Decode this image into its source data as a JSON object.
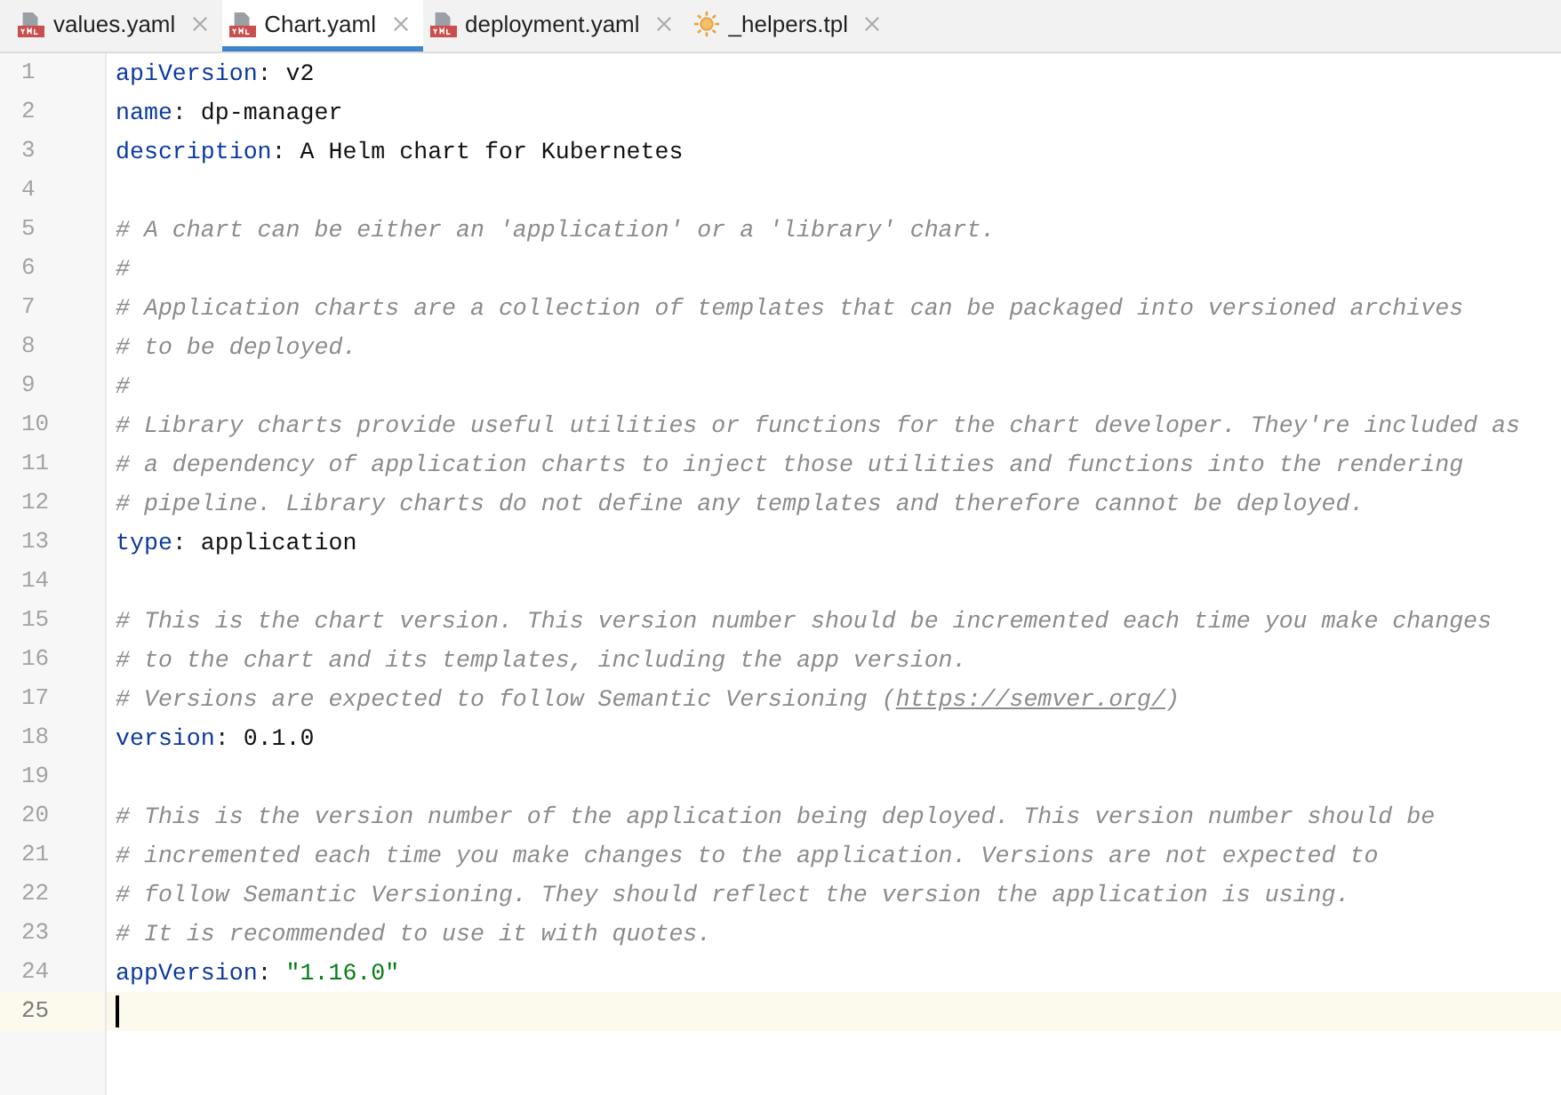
{
  "tabs": [
    {
      "label": "values.yaml",
      "kind": "yaml",
      "selected": false
    },
    {
      "label": "Chart.yaml",
      "kind": "yaml",
      "selected": true
    },
    {
      "label": "deployment.yaml",
      "kind": "yaml",
      "selected": false
    },
    {
      "label": "_helpers.tpl",
      "kind": "template",
      "selected": false
    }
  ],
  "lines": [
    {
      "number": "1",
      "kind": "pair",
      "key": "apiVersion",
      "separator": ":",
      "value": "v2",
      "current": false
    },
    {
      "number": "2",
      "kind": "pair",
      "key": "name",
      "separator": ":",
      "value": "dp-manager",
      "current": false
    },
    {
      "number": "3",
      "kind": "pair",
      "key": "description",
      "separator": ":",
      "value": "A Helm chart for Kubernetes",
      "current": false
    },
    {
      "number": "4",
      "kind": "blank",
      "current": false
    },
    {
      "number": "5",
      "kind": "comment",
      "text": "# A chart can be either an 'application' or a 'library' chart.",
      "current": false
    },
    {
      "number": "6",
      "kind": "comment",
      "text": "#",
      "current": false
    },
    {
      "number": "7",
      "kind": "comment",
      "text": "# Application charts are a collection of templates that can be packaged into versioned archives",
      "current": false
    },
    {
      "number": "8",
      "kind": "comment",
      "text": "# to be deployed.",
      "current": false
    },
    {
      "number": "9",
      "kind": "comment",
      "text": "#",
      "current": false
    },
    {
      "number": "10",
      "kind": "comment",
      "text": "# Library charts provide useful utilities or functions for the chart developer. They're included as",
      "current": false
    },
    {
      "number": "11",
      "kind": "comment",
      "text": "# a dependency of application charts to inject those utilities and functions into the rendering",
      "current": false
    },
    {
      "number": "12",
      "kind": "comment",
      "text": "# pipeline. Library charts do not define any templates and therefore cannot be deployed.",
      "current": false
    },
    {
      "number": "13",
      "kind": "pair",
      "key": "type",
      "separator": ":",
      "value": "application",
      "current": false
    },
    {
      "number": "14",
      "kind": "blank",
      "current": false
    },
    {
      "number": "15",
      "kind": "comment",
      "text": "# This is the chart version. This version number should be incremented each time you make changes",
      "current": false
    },
    {
      "number": "16",
      "kind": "comment",
      "text": "# to the chart and its templates, including the app version.",
      "current": false
    },
    {
      "number": "17",
      "kind": "comment_link",
      "text": "# Versions are expected to follow Semantic Versioning (",
      "link": "https://semver.org/",
      "text_after": ")",
      "current": false
    },
    {
      "number": "18",
      "kind": "pair",
      "key": "version",
      "separator": ":",
      "value": "0.1.0",
      "current": false
    },
    {
      "number": "19",
      "kind": "blank",
      "current": false
    },
    {
      "number": "20",
      "kind": "comment",
      "text": "# This is the version number of the application being deployed. This version number should be",
      "current": false
    },
    {
      "number": "21",
      "kind": "comment",
      "text": "# incremented each time you make changes to the application. Versions are not expected to",
      "current": false
    },
    {
      "number": "22",
      "kind": "comment",
      "text": "# follow Semantic Versioning. They should reflect the version the application is using.",
      "current": false
    },
    {
      "number": "23",
      "kind": "comment",
      "text": "# It is recommended to use it with quotes.",
      "current": false
    },
    {
      "number": "24",
      "kind": "pair_quoted",
      "key": "appVersion",
      "separator": ":",
      "value": "\"1.16.0\"",
      "current": false
    },
    {
      "number": "25",
      "kind": "blank",
      "current": true
    }
  ]
}
